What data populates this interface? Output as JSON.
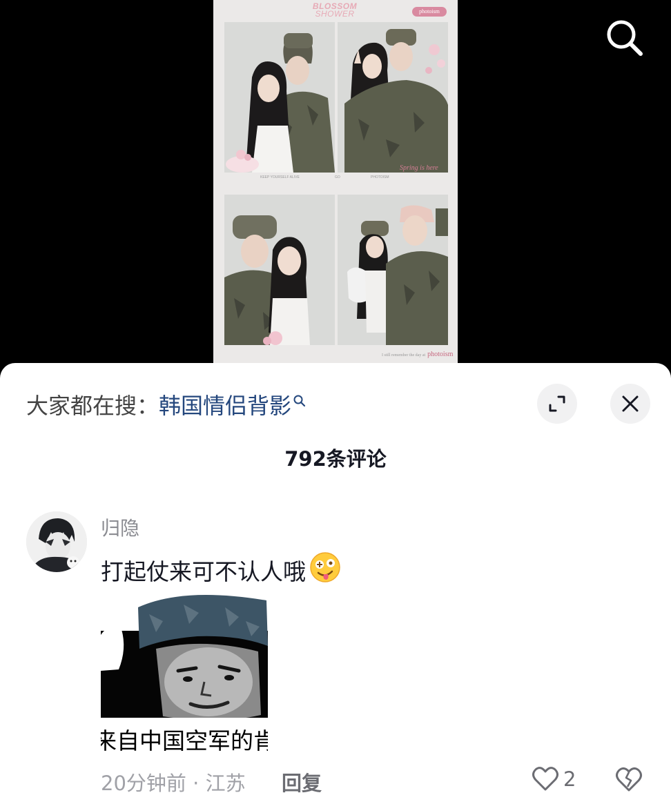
{
  "video": {
    "strip_title_line1": "BLOSSOM",
    "strip_title_line2": "SHOWER",
    "strip_brand": "photoism",
    "caption_left": "KEEP YOURSELF ALIVE",
    "caption_mid": "GO",
    "caption_right": "PHOTOISM",
    "spring_label": "Spring is here",
    "footer_small": "I still remember the day at",
    "footer_brand": "photoism",
    "search_icon": "search-icon"
  },
  "sheet": {
    "trend_prefix": "大家都在搜：",
    "trend_query": "韩国情侣背影",
    "comment_count": "792条评论",
    "expand_icon": "expand-icon",
    "close_icon": "close-icon"
  },
  "comment": {
    "author": "归隐",
    "text": "打起仗来可不认人哦",
    "emoji": "woozy-face-emoji",
    "sticker_caption": "来自中国空军的肯定",
    "time": "20分钟前",
    "separator": " · ",
    "location": "江苏",
    "reply_label": "回复",
    "like_count": "2"
  },
  "colors": {
    "sheet_bg": "#ffffff",
    "trend_link": "#24477d",
    "muted_text": "#a0a1a7",
    "blossom_pink": "#e7aab6"
  }
}
